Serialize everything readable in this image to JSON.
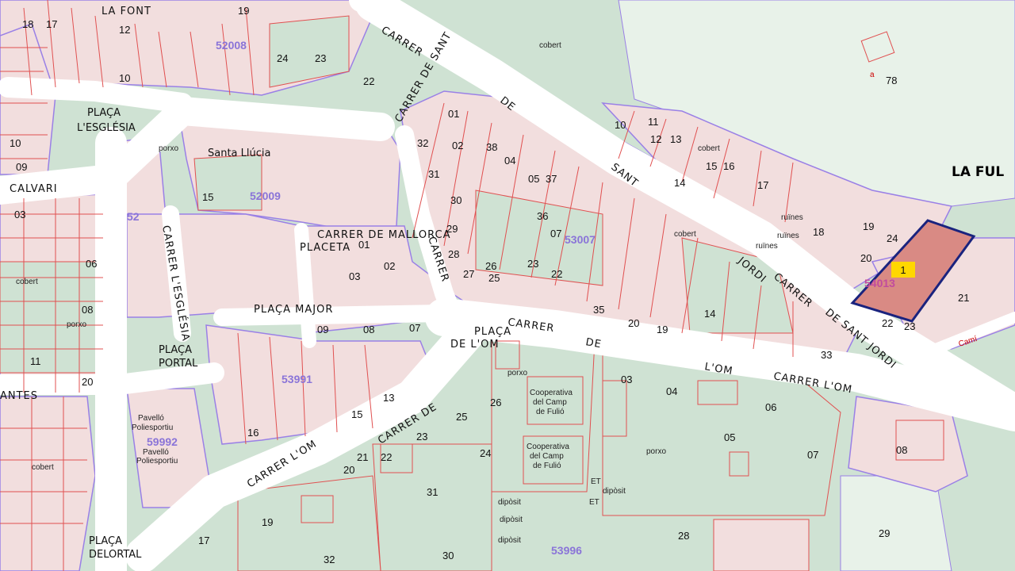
{
  "colors": {
    "parcel_fill": "#f2dede",
    "parcel_line": "#e05050",
    "block_line": "#9a80e6",
    "green": "#cfe2d3",
    "open_area": "#e8f2e9",
    "road": "#ffffff",
    "zone_label": "#8a74d8",
    "highlight_fill": "#d98a84",
    "highlight_line": "#1a237e",
    "badge": "#ffd700"
  },
  "streets": {
    "carrer_top": "CARRER",
    "la_font": "LA  FONT",
    "placa_esglesia_1": "PLAÇA",
    "placa_esglesia_2": "L'ESGLÉSIA",
    "calvari": "CALVARI",
    "santa_llucia": "Santa Llúcia",
    "carrer_de_sant": "CARRER DE SANT",
    "de": "DE",
    "sant": "SANT",
    "jordi": "JORDI",
    "carrer_mid": "CARRER",
    "de2": "DE",
    "sant_jordi": "SANT JORDI",
    "carrer_de_mallorca": "CARRER DE MALLORCA",
    "placeta": "PLACETA",
    "placa_major": "PLAÇA MAJOR",
    "placa_de_lom_1": "PLAÇA",
    "placa_de_lom_2": "DE L'OM",
    "carrer_de_lom": "CARRER",
    "de3": "DE",
    "lom": "L'OM",
    "carrer_lom_right": "CARRER  L'OM",
    "carrer_de_lom_low": "CARRER  DE",
    "carrer_lom_low2": "CARRER  L'OM",
    "placa_portal_1": "PLAÇA",
    "placa_portal_2": "PORTAL",
    "placa_delortal_1": "PLAÇA",
    "placa_delortal_2": "DELORTAL",
    "antes": "ANTES",
    "la_ful": "LA FUL",
    "cami": "Camí",
    "carrer_lesglesia": "CARRER L'ESGLÉSIA",
    "carrer_vert": "CARRER"
  },
  "buildings": {
    "pavello_1": "Pavelló",
    "pavello_2": "Poliesportiu",
    "pavello_3": "Pavelló",
    "pavello_4": "Poliesportiu",
    "coop_1": "Cooperativa",
    "coop_2": "del Camp",
    "coop_3": "de Fulió",
    "coop_4": "Cooperativa",
    "coop_5": "del Camp",
    "coop_6": "de Fulió",
    "porxo": "porxo",
    "cobert": "cobert",
    "ruines": "ruïnes",
    "diposit": "dipòsit",
    "et": "ET"
  },
  "zones": {
    "z1": "52008",
    "z2": "52009",
    "z3": "53007",
    "z4": "53991",
    "z5": "59992",
    "z6": "53996",
    "z7": "54013",
    "z8": "52"
  },
  "parcels": {
    "n18": "18",
    "n17": "17",
    "n19": "19",
    "n24": "24",
    "n23": "23",
    "n22": "22",
    "n01": "01",
    "n32": "32",
    "n02": "02",
    "n38": "38",
    "n04": "04",
    "n05": "05",
    "n37": "37",
    "n36": "36",
    "n07": "07",
    "n08": "08",
    "n10": "10",
    "n11": "11",
    "n12": "12",
    "n13": "13",
    "n14": "14",
    "n15": "15",
    "n16": "16",
    "n20": "20",
    "n21": "21",
    "n25": "25",
    "n26": "26",
    "n27": "27",
    "n28": "28",
    "n29": "29",
    "n30": "30",
    "n31": "31",
    "n33": "33",
    "n35": "35",
    "n03": "03",
    "n06": "06",
    "n09": "09",
    "n78": "78",
    "a": "a"
  },
  "highlight_badge": "1"
}
